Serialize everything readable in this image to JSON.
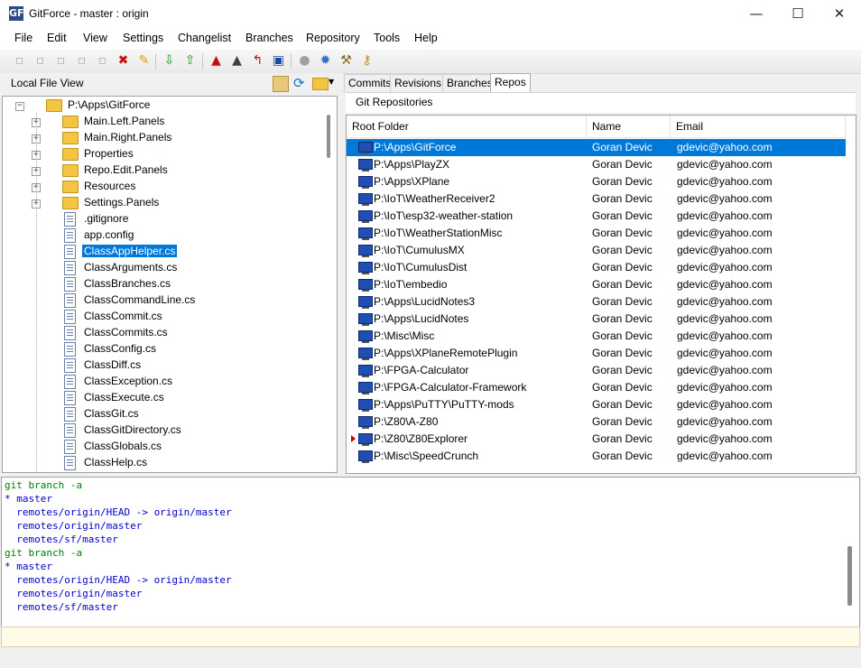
{
  "window": {
    "icon_text": "GF",
    "title": "GitForce - master : origin",
    "minimize_glyph": "—",
    "maximize_glyph": "☐",
    "close_glyph": "✕"
  },
  "menu": [
    "File",
    "Edit",
    "View",
    "Settings",
    "Changelist",
    "Branches",
    "Repository",
    "Tools",
    "Help"
  ],
  "toolbar": {
    "icons": [
      "new-file-icon",
      "add-icon",
      "edit-icon",
      "revert-icon",
      "delete-file-icon",
      "delete-icon",
      "rename-icon",
      "pull-icon",
      "push-icon",
      "merge-icon",
      "branch-icon",
      "checkout-icon",
      "command-prompt-icon",
      "stop-icon",
      "settings-gear-icon",
      "tools-icon",
      "keys-icon"
    ],
    "glyphs": [
      "▫",
      "▫",
      "▫",
      "▫",
      "▫",
      "✖",
      "✎",
      "⇩",
      "⇧",
      "▲",
      "▲",
      "↰",
      "▣",
      "●",
      "✹",
      "⚒",
      "⚷"
    ]
  },
  "left_panel": {
    "title": "Local File View",
    "root": "P:\\Apps\\GitForce",
    "folders": [
      "Main.Left.Panels",
      "Main.Right.Panels",
      "Properties",
      "Repo.Edit.Panels",
      "Resources",
      "Settings.Panels"
    ],
    "files": [
      ".gitignore",
      "app.config",
      "ClassAppHelper.cs",
      "ClassArguments.cs",
      "ClassBranches.cs",
      "ClassCommandLine.cs",
      "ClassCommit.cs",
      "ClassCommits.cs",
      "ClassConfig.cs",
      "ClassDiff.cs",
      "ClassException.cs",
      "ClassExecute.cs",
      "ClassGit.cs",
      "ClassGitDirectory.cs",
      "ClassGlobals.cs",
      "ClassHelp.cs"
    ],
    "selected_file": "ClassAppHelper.cs",
    "expand_glyph": "+",
    "collapse_glyph": "−"
  },
  "tabs": [
    "Commits",
    "Revisions",
    "Branches",
    "Repos"
  ],
  "active_tab": "Repos",
  "repos": {
    "title": "Git Repositories",
    "columns": [
      "Root Folder",
      "Name",
      "Email"
    ],
    "rows": [
      {
        "root": "P:\\Apps\\GitForce",
        "name": "Goran Devic",
        "email": "gdevic@yahoo.com"
      },
      {
        "root": "P:\\Apps\\PlayZX",
        "name": "Goran Devic",
        "email": "gdevic@yahoo.com"
      },
      {
        "root": "P:\\Apps\\XPlane",
        "name": "Goran Devic",
        "email": "gdevic@yahoo.com"
      },
      {
        "root": "P:\\IoT\\WeatherReceiver2",
        "name": "Goran Devic",
        "email": "gdevic@yahoo.com"
      },
      {
        "root": "P:\\IoT\\esp32-weather-station",
        "name": "Goran Devic",
        "email": "gdevic@yahoo.com"
      },
      {
        "root": "P:\\IoT\\WeatherStationMisc",
        "name": "Goran Devic",
        "email": "gdevic@yahoo.com"
      },
      {
        "root": "P:\\IoT\\CumulusMX",
        "name": "Goran Devic",
        "email": "gdevic@yahoo.com"
      },
      {
        "root": "P:\\IoT\\CumulusDist",
        "name": "Goran Devic",
        "email": "gdevic@yahoo.com"
      },
      {
        "root": "P:\\IoT\\embedio",
        "name": "Goran Devic",
        "email": "gdevic@yahoo.com"
      },
      {
        "root": "P:\\Apps\\LucidNotes3",
        "name": "Goran Devic",
        "email": "gdevic@yahoo.com"
      },
      {
        "root": "P:\\Apps\\LucidNotes",
        "name": "Goran Devic",
        "email": "gdevic@yahoo.com"
      },
      {
        "root": "P:\\Misc\\Misc",
        "name": "Goran Devic",
        "email": "gdevic@yahoo.com"
      },
      {
        "root": "P:\\Apps\\XPlaneRemotePlugin",
        "name": "Goran Devic",
        "email": "gdevic@yahoo.com"
      },
      {
        "root": "P:\\FPGA-Calculator",
        "name": "Goran Devic",
        "email": "gdevic@yahoo.com"
      },
      {
        "root": "P:\\FPGA-Calculator-Framework",
        "name": "Goran Devic",
        "email": "gdevic@yahoo.com"
      },
      {
        "root": "P:\\Apps\\PuTTY\\PuTTY-mods",
        "name": "Goran Devic",
        "email": "gdevic@yahoo.com"
      },
      {
        "root": "P:\\Z80\\A-Z80",
        "name": "Goran Devic",
        "email": "gdevic@yahoo.com"
      },
      {
        "root": "P:\\Z80\\Z80Explorer",
        "name": "Goran Devic",
        "email": "gdevic@yahoo.com"
      },
      {
        "root": "P:\\Misc\\SpeedCrunch",
        "name": "Goran Devic",
        "email": "gdevic@yahoo.com"
      }
    ],
    "selected_row": 0,
    "marked_row": 17
  },
  "output": [
    {
      "text": "git branch -a",
      "color": "#008000"
    },
    {
      "text": "* master",
      "color": "#0000cc"
    },
    {
      "text": "  remotes/origin/HEAD -> origin/master",
      "color": "#0000cc"
    },
    {
      "text": "  remotes/origin/master",
      "color": "#0000cc"
    },
    {
      "text": "  remotes/sf/master",
      "color": "#0000cc"
    },
    {
      "text": "git branch -a",
      "color": "#008000"
    },
    {
      "text": "* master",
      "color": "#0000cc"
    },
    {
      "text": "  remotes/origin/HEAD -> origin/master",
      "color": "#0000cc"
    },
    {
      "text": "  remotes/origin/master",
      "color": "#0000cc"
    },
    {
      "text": "  remotes/sf/master",
      "color": "#0000cc"
    }
  ],
  "status": ""
}
